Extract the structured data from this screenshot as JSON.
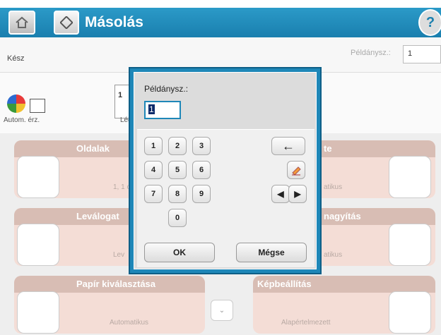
{
  "header": {
    "title": "Másolás"
  },
  "status": {
    "text": "Kész",
    "copies_label": "Példánysz.:",
    "copies_value": "1"
  },
  "controls": {
    "color_label": "Autom. érz.",
    "preview_number": "1",
    "layout_label": "Lég"
  },
  "options": [
    {
      "name": "oldalak",
      "header": "Oldalak",
      "value": "1, 1 o"
    },
    {
      "name": "leválogatás",
      "header": "Leválogat",
      "value": "Lev"
    },
    {
      "name": "papir",
      "header": "Papír kiválasztása",
      "value": "Automatikus"
    },
    {
      "name": "szines",
      "header": "te",
      "value": "atikus"
    },
    {
      "name": "nagyitas",
      "header": "nagyítás",
      "value": "atikus"
    },
    {
      "name": "kepbeallitas",
      "header": "Képbeállítás",
      "value": "Alapértelmezett"
    }
  ],
  "dialog": {
    "label": "Példánysz.:",
    "input_value": "1",
    "keys": [
      "1",
      "2",
      "3",
      "4",
      "5",
      "6",
      "7",
      "8",
      "9",
      "0"
    ],
    "backspace_symbol": "←",
    "left_symbol": "◀",
    "right_symbol": "▶",
    "ok_label": "OK",
    "cancel_label": "Mégse"
  }
}
